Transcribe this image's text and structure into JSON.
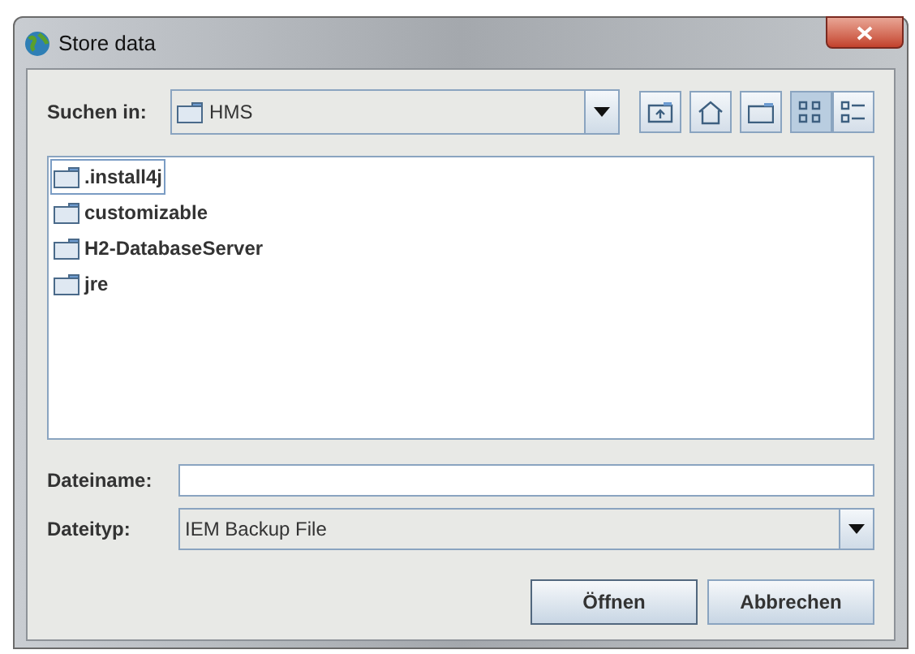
{
  "window": {
    "title": "Store data"
  },
  "look_in": {
    "label": "Suchen in:",
    "value": "HMS"
  },
  "toolbar": [
    {
      "kind": "up",
      "selected": false
    },
    {
      "kind": "home",
      "selected": false
    },
    {
      "kind": "newfolder",
      "selected": false
    },
    {
      "kind": "list",
      "selected": true
    },
    {
      "kind": "details",
      "selected": false
    }
  ],
  "files": [
    {
      "name": ".install4j",
      "selected": true
    },
    {
      "name": "customizable",
      "selected": false
    },
    {
      "name": "H2-DatabaseServer",
      "selected": false
    },
    {
      "name": "jre",
      "selected": false
    }
  ],
  "file_name": {
    "label": "Dateiname:"
  },
  "file_type": {
    "label": "Dateityp:",
    "value": "IEM Backup File"
  },
  "buttons": [
    {
      "label": "Öffnen",
      "default": true
    },
    {
      "label": "Abbrechen",
      "default": false
    }
  ]
}
